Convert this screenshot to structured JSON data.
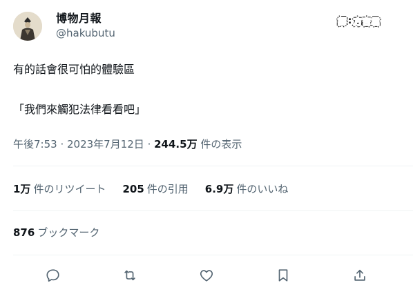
{
  "user": {
    "display_name": "博物月報",
    "handle": "@hakubutu"
  },
  "translator_badge": {
    "label": "譯",
    "separator": ":",
    "name": "方吉君"
  },
  "tweet": {
    "line1": "有的話會很可怕的體驗區",
    "line2": "「我們來觸犯法律看看吧」"
  },
  "meta": {
    "time": "午後7:53",
    "dot1": " · ",
    "date": "2023年7月12日",
    "dot2": " · ",
    "views_count": "244.5万",
    "views_label": " 件の表示"
  },
  "stats": {
    "retweets_count": "1万",
    "retweets_label": "件のリツイート",
    "quotes_count": "205",
    "quotes_label": "件の引用",
    "likes_count": "6.9万",
    "likes_label": "件のいいね"
  },
  "bookmarks": {
    "count": "876",
    "label": "ブックマーク"
  },
  "colors": {
    "text": "#0f1419",
    "secondary": "#536471",
    "divider": "#eff3f4"
  },
  "icons": [
    "reply-icon",
    "retweet-icon",
    "like-icon",
    "bookmark-icon",
    "share-icon"
  ]
}
